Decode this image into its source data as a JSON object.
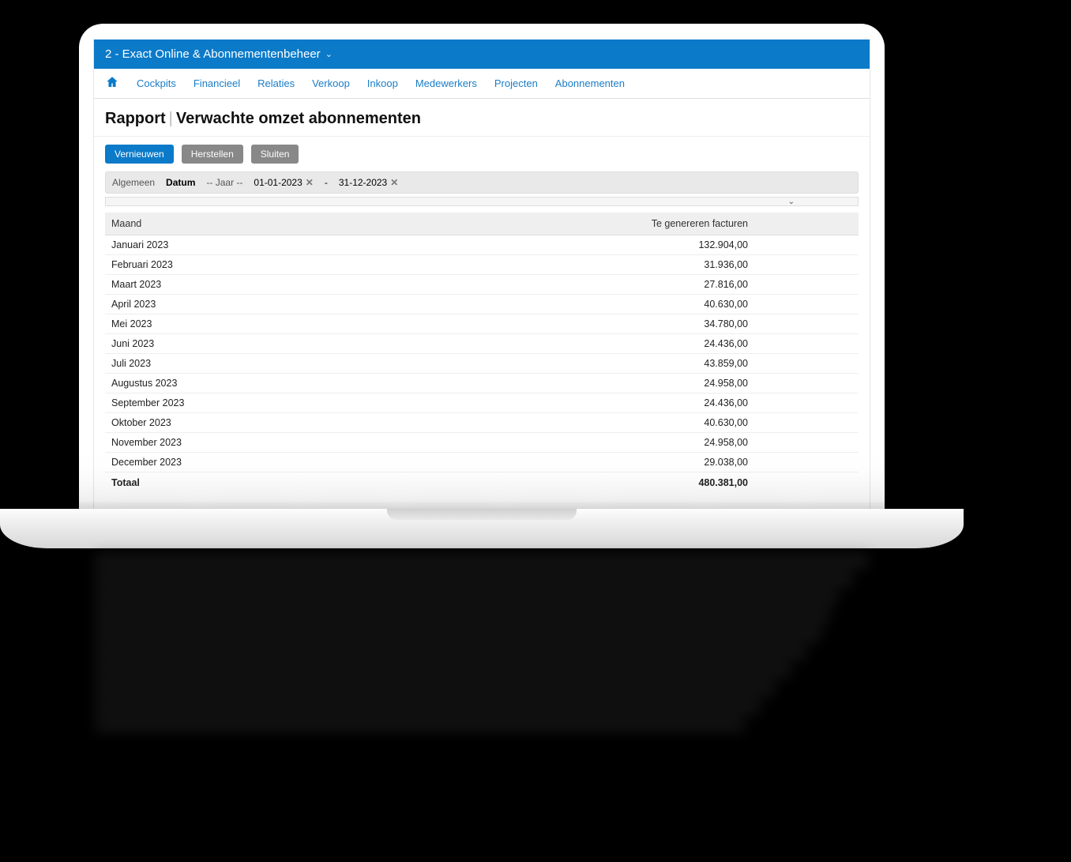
{
  "header": {
    "title": "2 - Exact Online & Abonnementenbeheer"
  },
  "nav": {
    "items": [
      "Cockpits",
      "Financieel",
      "Relaties",
      "Verkoop",
      "Inkoop",
      "Medewerkers",
      "Projecten",
      "Abonnementen"
    ]
  },
  "page": {
    "title_prefix": "Rapport",
    "title": "Verwachte omzet abonnementen"
  },
  "toolbar": {
    "refresh": "Vernieuwen",
    "restore": "Herstellen",
    "close": "Sluiten"
  },
  "filter": {
    "tab": "Algemeen",
    "date_label": "Datum",
    "year_placeholder": "-- Jaar --",
    "date_from": "01-01-2023",
    "separator": "-",
    "date_to": "31-12-2023"
  },
  "table": {
    "col_month": "Maand",
    "col_value": "Te genereren facturen",
    "rows": [
      {
        "month": "Januari 2023",
        "value": "132.904,00"
      },
      {
        "month": "Februari 2023",
        "value": "31.936,00"
      },
      {
        "month": "Maart 2023",
        "value": "27.816,00"
      },
      {
        "month": "April 2023",
        "value": "40.630,00"
      },
      {
        "month": "Mei 2023",
        "value": "34.780,00"
      },
      {
        "month": "Juni 2023",
        "value": "24.436,00"
      },
      {
        "month": "Juli 2023",
        "value": "43.859,00"
      },
      {
        "month": "Augustus 2023",
        "value": "24.958,00"
      },
      {
        "month": "September 2023",
        "value": "24.436,00"
      },
      {
        "month": "Oktober 2023",
        "value": "40.630,00"
      },
      {
        "month": "November 2023",
        "value": "24.958,00"
      },
      {
        "month": "December 2023",
        "value": "29.038,00"
      }
    ],
    "total_label": "Totaal",
    "total_value": "480.381,00"
  }
}
